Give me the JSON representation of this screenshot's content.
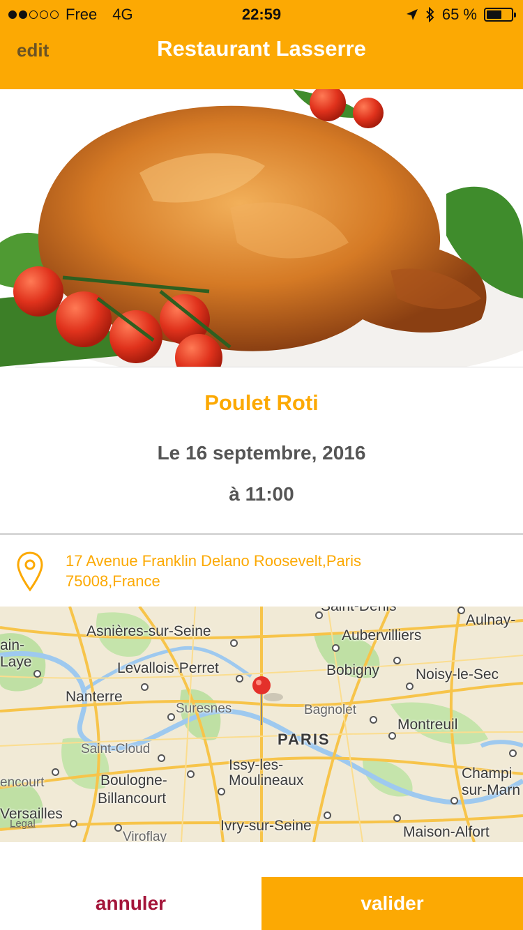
{
  "status_bar": {
    "carrier": "Free",
    "network": "4G",
    "time": "22:59",
    "battery": "65 %",
    "battery_level": 0.65,
    "icons": [
      "signal-dots",
      "location-arrow-icon",
      "bluetooth-icon",
      "battery-icon"
    ]
  },
  "nav": {
    "edit_label": "edit",
    "title": "Restaurant Lasserre"
  },
  "dish": {
    "name": "Poulet Roti",
    "date": "Le 16 septembre, 2016",
    "time": "à 11:00"
  },
  "address": {
    "line1": "17 Avenue Franklin Delano Roosevelt,Paris",
    "line2": "75008,France",
    "icon": "map-pin-icon"
  },
  "map": {
    "legal": "Legal",
    "labels": {
      "saint_denis": "Saint-Denis",
      "aulnay": "Aulnay-",
      "saint_germain_top": "ain-",
      "saint_germain_bottom": "Laye",
      "asnieres": "Asnières-sur-Seine",
      "aubervilliers": "Aubervilliers",
      "levallois": "Levallois-Perret",
      "bobigny": "Bobigny",
      "noisy": "Noisy-le-Sec",
      "nanterre": "Nanterre",
      "suresnes": "Suresnes",
      "bagnolet": "Bagnolet",
      "montreuil": "Montreuil",
      "paris": "PARIS",
      "saint_cloud": "Saint-Cloud",
      "issy_top": "Issy-les-",
      "issy_bottom": "Moulineaux",
      "courcouronnes": "encourt",
      "boulogne_top": "Boulogne-",
      "boulogne_bottom": "Billancourt",
      "champigny_top": "Champi",
      "champigny_bottom": "sur-Marn",
      "versailles": "Versailles",
      "viroflay": "Viroflay",
      "ivry": "Ivry-sur-Seine",
      "maison_alfort": "Maison-Alfort"
    }
  },
  "actions": {
    "cancel": "annuler",
    "confirm": "valider"
  },
  "colors": {
    "accent": "#FCA903",
    "cancel_text": "#A4153A",
    "body_text": "#555555"
  }
}
